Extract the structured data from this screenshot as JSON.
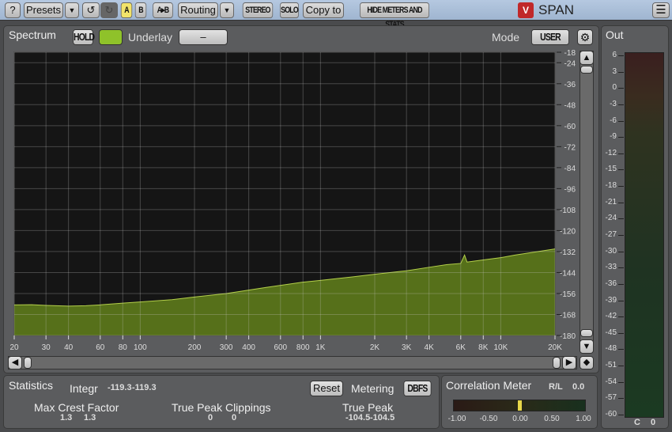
{
  "toolbar": {
    "help": "?",
    "presets": "Presets",
    "a": "A",
    "b": "B",
    "a_to_b": "A▸B",
    "routing": "Routing",
    "stereo": "STEREO",
    "solo": "SOLO",
    "copy_to": "Copy to",
    "hide_meters": "HIDE METERS AND STATS",
    "brand": "SPAN"
  },
  "spectrum": {
    "tab": "Spectrum",
    "hold": "HOLD",
    "underlay_label": "Underlay",
    "underlay_value": "–",
    "mode_label": "Mode",
    "mode_value": "USER",
    "accent": "#8fc22a"
  },
  "out": {
    "tab": "Out",
    "scale": [
      "6",
      "3",
      "0",
      "-3",
      "-6",
      "-9",
      "-12",
      "-15",
      "-18",
      "-21",
      "-24",
      "-27",
      "-30",
      "-33",
      "-36",
      "-39",
      "-42",
      "-45",
      "-48",
      "-51",
      "-54",
      "-57",
      "-60"
    ],
    "channels": [
      "C",
      "0"
    ]
  },
  "chart_data": {
    "type": "area",
    "xscale": "log",
    "xlim": [
      20,
      20000
    ],
    "ylim": [
      -180,
      -18
    ],
    "x_ticks": [
      "20",
      "30",
      "40",
      "60",
      "80",
      "100",
      "200",
      "300",
      "400",
      "600",
      "800",
      "1K",
      "2K",
      "3K",
      "4K",
      "6K",
      "8K",
      "10K",
      "20K"
    ],
    "x_tick_values": [
      20,
      30,
      40,
      60,
      80,
      100,
      200,
      300,
      400,
      600,
      800,
      1000,
      2000,
      3000,
      4000,
      6000,
      8000,
      10000,
      20000
    ],
    "y_ticks": [
      "-18",
      "-24",
      "-36",
      "-48",
      "-60",
      "-72",
      "-84",
      "-96",
      "-108",
      "-120",
      "-132",
      "-144",
      "-156",
      "-168",
      "-180"
    ],
    "y_tick_values": [
      -18,
      -24,
      -36,
      -48,
      -60,
      -72,
      -84,
      -96,
      -108,
      -120,
      -132,
      -144,
      -156,
      -168,
      -180
    ],
    "grid": true,
    "fill_color": "#56701a",
    "line_color": "#b4d04a",
    "x": [
      20,
      25,
      30,
      40,
      50,
      60,
      80,
      100,
      150,
      200,
      300,
      500,
      800,
      1000,
      1500,
      2000,
      3000,
      4000,
      5000,
      6000,
      6300,
      6500,
      7000,
      8000,
      10000,
      12000,
      15000,
      20000
    ],
    "y": [
      -162.5,
      -162.4,
      -162.8,
      -163.2,
      -163,
      -162.5,
      -161.5,
      -160.8,
      -159.5,
      -158,
      -156,
      -152.5,
      -149.5,
      -148.5,
      -146.5,
      -145,
      -143,
      -141,
      -139.5,
      -138.8,
      -134,
      -138,
      -137.6,
      -136.8,
      -135.5,
      -134,
      -132.5,
      -130.5
    ]
  },
  "stats": {
    "tab": "Statistics",
    "integr_label": "Integr",
    "integr_values": [
      "-119.3",
      "-119.3"
    ],
    "reset": "Reset",
    "metering_label": "Metering",
    "metering_value": "DBFS",
    "crest_label": "Max Crest Factor",
    "crest_values": [
      "1.3",
      "1.3"
    ],
    "clip_label": "True Peak Clippings",
    "clip_values": [
      "0",
      "0"
    ],
    "tp_label": "True Peak",
    "tp_values": [
      "-104.5",
      "-104.5"
    ]
  },
  "correlation": {
    "tab": "Correlation Meter",
    "channel": "R/L",
    "value": "0.0",
    "scale": [
      "-1.00",
      "-0.50",
      "0.00",
      "0.50",
      "1.00"
    ],
    "level": 0.0
  }
}
